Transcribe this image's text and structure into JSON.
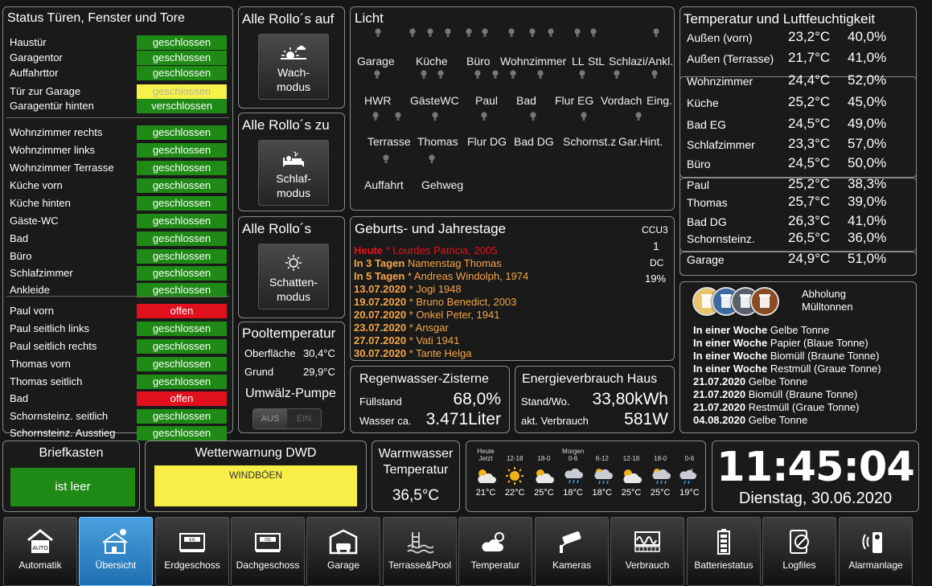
{
  "status": {
    "title": "Status Türen, Fenster und Tore",
    "groups": [
      [
        {
          "label": "Haustür",
          "state": "geschlossen",
          "kind": "ok"
        },
        {
          "label": "Garagentor",
          "state": "geschlossen",
          "kind": "ok"
        },
        {
          "label": "Auffahrttor",
          "state": "geschlossen",
          "kind": "ok"
        },
        {
          "label": "Tür zur Garage",
          "state": "geschlossen",
          "kind": "warn"
        },
        {
          "label": "Garagentür hinten",
          "state": "verschlossen",
          "kind": "ok"
        }
      ],
      [
        {
          "label": "Wohnzimmer rechts",
          "state": "geschlossen",
          "kind": "ok"
        },
        {
          "label": "Wohnzimmer links",
          "state": "geschlossen",
          "kind": "ok"
        },
        {
          "label": "Wohnzimmer Terrasse",
          "state": "geschlossen",
          "kind": "ok"
        },
        {
          "label": "Küche vorn",
          "state": "geschlossen",
          "kind": "ok"
        },
        {
          "label": "Küche hinten",
          "state": "geschlossen",
          "kind": "ok"
        },
        {
          "label": "Gäste-WC",
          "state": "geschlossen",
          "kind": "ok"
        },
        {
          "label": "Bad",
          "state": "geschlossen",
          "kind": "ok"
        },
        {
          "label": "Büro",
          "state": "geschlossen",
          "kind": "ok"
        },
        {
          "label": "Schlafzimmer",
          "state": "geschlossen",
          "kind": "ok"
        },
        {
          "label": "Ankleide",
          "state": "geschlossen",
          "kind": "ok"
        }
      ],
      [
        {
          "label": "Paul vorn",
          "state": "offen",
          "kind": "bad"
        },
        {
          "label": "Paul seitlich links",
          "state": "geschlossen",
          "kind": "ok"
        },
        {
          "label": "Paul seitlich rechts",
          "state": "geschlossen",
          "kind": "ok"
        },
        {
          "label": "Thomas vorn",
          "state": "geschlossen",
          "kind": "ok"
        },
        {
          "label": "Thomas seitlich",
          "state": "geschlossen",
          "kind": "ok"
        },
        {
          "label": "Bad",
          "state": "offen",
          "kind": "bad"
        },
        {
          "label": "Schornsteinz. seitlich",
          "state": "geschlossen",
          "kind": "ok"
        },
        {
          "label": "Schornsteinz. Ausstieg",
          "state": "geschlossen",
          "kind": "ok"
        }
      ]
    ]
  },
  "rollo": {
    "auf": {
      "title": "Alle Rollo´s auf",
      "btn1": "Wach-",
      "btn2": "modus"
    },
    "zu": {
      "title": "Alle Rollo´s zu",
      "btn1": "Schlaf-",
      "btn2": "modus"
    },
    "schatten": {
      "title": "Alle Rollo´s",
      "btn1": "Schatten-",
      "btn2": "modus"
    }
  },
  "pool": {
    "title": "Pooltemperatur",
    "surface_label": "Oberfläche",
    "surface_value": "30,4°C",
    "ground_label": "Grund",
    "ground_value": "29,9°C",
    "pump_title": "Umwälz-Pumpe",
    "off": "AUS",
    "on": "EIN"
  },
  "licht": {
    "title": "Licht",
    "rooms": [
      "Garage",
      "Küche",
      "Büro",
      "Wohnzimmer",
      "LL",
      "StL",
      "Schlazi/Ankl.",
      "HWR",
      "GästeWC",
      "Paul",
      "Bad",
      "Flur EG",
      "Vordach",
      "Eing.",
      "Terrasse",
      "Thomas",
      "Flur DG",
      "Bad DG",
      "Schornst.z",
      "Gar.Hint.",
      "Auffahrt",
      "Gehweg"
    ]
  },
  "events": {
    "title": "Geburts- und Jahrestage",
    "ccu_label": "CCU3",
    "ccu_value": "1",
    "dc_label": "DC",
    "dc_value": "19%",
    "items": [
      {
        "date": "Heute",
        "text": " * Lourdes Patricia, 2005",
        "color": "#e8111b"
      },
      {
        "date": "In 3 Tagen",
        "text": " Namenstag Thomas",
        "color": "#f5a646"
      },
      {
        "date": "In 5 Tagen",
        "text": " * Andreas Windolph, 1974",
        "color": "#f5a646"
      },
      {
        "date": "13.07.2020",
        "text": " * Jogi 1948",
        "color": "#f5a646"
      },
      {
        "date": "19.07.2020",
        "text": " * Bruno Benedict, 2003",
        "color": "#f5a646"
      },
      {
        "date": "20.07.2020",
        "text": " * Onkel Peter, 1941",
        "color": "#f5a646"
      },
      {
        "date": "23.07.2020",
        "text": " * Ansgar",
        "color": "#f5a646"
      },
      {
        "date": "27.07.2020",
        "text": " * Vati 1941",
        "color": "#f5a646"
      },
      {
        "date": "30.07.2020",
        "text": " * Tante Helga",
        "color": "#f5a646"
      }
    ]
  },
  "zisterne": {
    "title": "Regenwasser-Zisterne",
    "fill_label": "Füllstand",
    "fill_value": "68,0%",
    "water_label": "Wasser ca.",
    "water_value": "3.471Liter"
  },
  "energie": {
    "title": "Energieverbrauch Haus",
    "stand_label": "Stand/Wo.",
    "stand_value": "33,80kWh",
    "akt_label": "akt. Verbrauch",
    "akt_value": "581W"
  },
  "temp": {
    "title": "Temperatur und Luftfeuchtigkeit",
    "groups": [
      [
        {
          "room": "Außen (vorn)",
          "t": "23,2°C",
          "h": "40,0%"
        },
        {
          "room": "Außen (Terrasse)",
          "t": "21,7°C",
          "h": "41,0%"
        }
      ],
      [
        {
          "room": "Wohnzimmer",
          "t": "24,4°C",
          "h": "52,0%"
        },
        {
          "room": "Küche",
          "t": "25,2°C",
          "h": "45,0%"
        },
        {
          "room": "Bad EG",
          "t": "24,5°C",
          "h": "49,0%"
        },
        {
          "room": "Schlafzimmer",
          "t": "23,3°C",
          "h": "57,0%"
        },
        {
          "room": "Büro",
          "t": "24,5°C",
          "h": "50,0%"
        }
      ],
      [
        {
          "room": "Paul",
          "t": "25,2°C",
          "h": "38,3%"
        },
        {
          "room": "Thomas",
          "t": "25,7°C",
          "h": "39,0%"
        },
        {
          "room": "Bad DG",
          "t": "26,3°C",
          "h": "41,0%"
        },
        {
          "room": "Schornsteinz.",
          "t": "26,5°C",
          "h": "36,0%"
        }
      ],
      [
        {
          "room": "Garage",
          "t": "24,9°C",
          "h": "51,0%"
        }
      ]
    ]
  },
  "muell": {
    "title1": "Abholung",
    "title2": "Mülltonnen",
    "bin_colors": [
      "#e8c46a",
      "#3d6aa0",
      "#57606b",
      "#8a4a22"
    ],
    "items": [
      {
        "bold": "In einer Woche",
        "text": " Gelbe Tonne"
      },
      {
        "bold": "In einer Woche",
        "text": " Papier (Blaue Tonne)"
      },
      {
        "bold": "In einer Woche",
        "text": " Biomüll (Braune Tonne)"
      },
      {
        "bold": "In einer Woche",
        "text": " Restmüll (Graue Tonne)"
      },
      {
        "bold": "21.07.2020",
        "text": " Gelbe Tonne"
      },
      {
        "bold": "21.07.2020",
        "text": " Biomüll (Braune Tonne)"
      },
      {
        "bold": "21.07.2020",
        "text": " Restmüll (Graue Tonne)"
      },
      {
        "bold": "04.08.2020",
        "text": " Gelbe Tonne"
      }
    ]
  },
  "briefkasten": {
    "title": "Briefkasten",
    "status": "ist leer"
  },
  "dwd": {
    "title": "Wetterwarnung DWD",
    "warning": "WINDBÖEN"
  },
  "warmwasser": {
    "title1": "Warmwasser",
    "title2": "Temperatur",
    "value": "36,5°C"
  },
  "weather": [
    {
      "d1": "Heute",
      "d2": "Jetzt",
      "icon": "sun-cloud",
      "t": "21°C"
    },
    {
      "d1": "",
      "d2": "12-18",
      "icon": "sun",
      "t": "22°C"
    },
    {
      "d1": "",
      "d2": "18-0",
      "icon": "sun-cloud",
      "t": "25°C"
    },
    {
      "d1": "Morgen",
      "d2": "0-6",
      "icon": "rain",
      "t": "18°C"
    },
    {
      "d1": "",
      "d2": "6-12",
      "icon": "sun-rain",
      "t": "18°C"
    },
    {
      "d1": "",
      "d2": "12-18",
      "icon": "sun-cloud",
      "t": "25°C"
    },
    {
      "d1": "",
      "d2": "18-0",
      "icon": "sun-rain",
      "t": "25°C"
    },
    {
      "d1": "",
      "d2": "0-6",
      "icon": "moon-rain",
      "t": "19°C"
    }
  ],
  "clock": {
    "time": "11:45:04",
    "date": "Dienstag, 30.06.2020"
  },
  "nav": [
    {
      "label": "Automatik",
      "icon": "auto-house"
    },
    {
      "label": "Übersicht",
      "icon": "house-overview",
      "active": true
    },
    {
      "label": "Erdgeschoss",
      "icon": "eg-floor"
    },
    {
      "label": "Dachgeschoss",
      "icon": "og-floor"
    },
    {
      "label": "Garage",
      "icon": "garage"
    },
    {
      "label": "Terrasse&Pool",
      "icon": "pool"
    },
    {
      "label": "Temperatur",
      "icon": "weather"
    },
    {
      "label": "Kameras",
      "icon": "camera"
    },
    {
      "label": "Verbrauch",
      "icon": "meter"
    },
    {
      "label": "Batteriestatus",
      "icon": "battery"
    },
    {
      "label": "Logfiles",
      "icon": "log"
    },
    {
      "label": "Alarmanlage",
      "icon": "alarm"
    }
  ]
}
